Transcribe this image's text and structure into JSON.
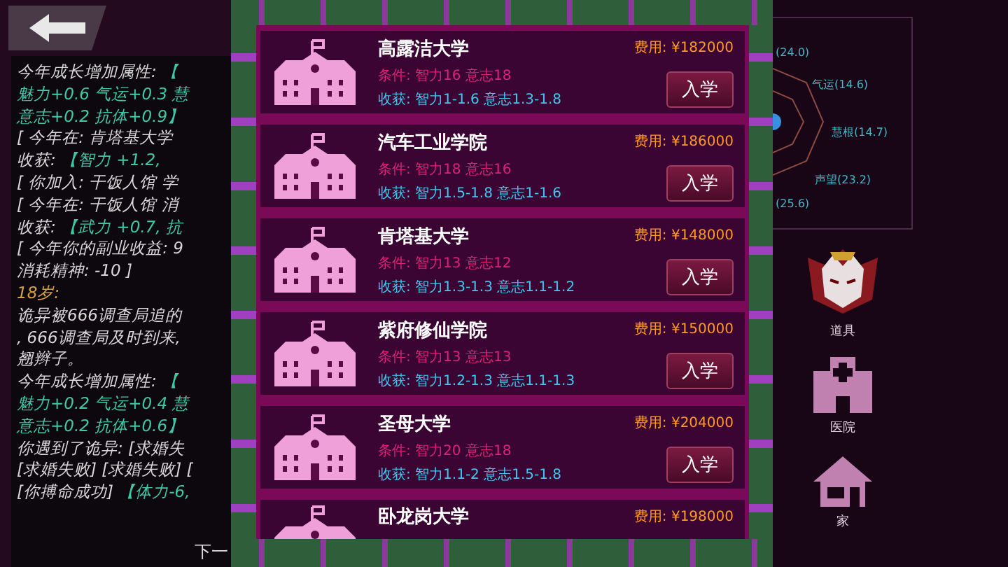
{
  "log": [
    [
      {
        "kind": "plain",
        "text": "今年成长增加属性: "
      },
      {
        "kind": "stat",
        "text": "【"
      }
    ],
    [
      {
        "kind": "stat",
        "text": "魅力+0.6 气运+0.3 慧"
      }
    ],
    [
      {
        "kind": "stat",
        "text": "意志+0.2 抗体+0.9】"
      }
    ],
    [
      {
        "kind": "plain",
        "text": "[ 今年在: 肯塔基大学"
      }
    ],
    [
      {
        "kind": "plain",
        "text": "收获: "
      },
      {
        "kind": "stat",
        "text": "【智力 +1.2,"
      }
    ],
    [
      {
        "kind": "plain",
        "text": "[ 你加入: 干饭人馆 学"
      }
    ],
    [
      {
        "kind": "plain",
        "text": "[ 今年在: 干饭人馆 消"
      }
    ],
    [
      {
        "kind": "plain",
        "text": "收获: "
      },
      {
        "kind": "stat",
        "text": "【武力 +0.7, 抗"
      }
    ],
    [
      {
        "kind": "plain",
        "text": "[ 今年你的副业收益: 9"
      }
    ],
    [
      {
        "kind": "plain",
        "text": "消耗精神: -10 ]"
      }
    ],
    [
      {
        "kind": "age",
        "text": "18岁:"
      }
    ],
    [
      {
        "kind": "plain",
        "text": "诡异被666调查局追的"
      }
    ],
    [
      {
        "kind": "plain",
        "text": ", 666调查局及时到来,"
      }
    ],
    [
      {
        "kind": "plain",
        "text": "翘辫子。"
      }
    ],
    [
      {
        "kind": "plain",
        "text": "今年成长增加属性: "
      },
      {
        "kind": "stat",
        "text": "【"
      }
    ],
    [
      {
        "kind": "stat",
        "text": "魅力+0.2 气运+0.4 慧"
      }
    ],
    [
      {
        "kind": "stat",
        "text": "意志+0.2 抗体+0.6】"
      }
    ],
    [
      {
        "kind": "plain",
        "text": "你遇到了诡异: [求婚失"
      }
    ],
    [
      {
        "kind": "plain",
        "text": "[求婚失败] [求婚失败] ["
      }
    ],
    [
      {
        "kind": "plain",
        "text": "[你搏命成功] "
      },
      {
        "kind": "stat",
        "text": "【体力-6,"
      }
    ]
  ],
  "next_year_button": "下一",
  "schools": [
    {
      "name": "高露洁大学",
      "condition": "条件: 智力16 意志18",
      "gain": "收获: 智力1-1.6 意志1.3-1.8",
      "fee": "费用: ¥182000",
      "button": "入学"
    },
    {
      "name": "汽车工业学院",
      "condition": "条件: 智力18 意志16",
      "gain": "收获: 智力1.5-1.8 意志1-1.6",
      "fee": "费用: ¥186000",
      "button": "入学"
    },
    {
      "name": "肯塔基大学",
      "condition": "条件: 智力13 意志12",
      "gain": "收获: 智力1.3-1.3 意志1.1-1.2",
      "fee": "费用: ¥148000",
      "button": "入学"
    },
    {
      "name": "紫府修仙学院",
      "condition": "条件: 智力13 意志13",
      "gain": "收获: 智力1.2-1.3 意志1.1-1.3",
      "fee": "费用: ¥150000",
      "button": "入学"
    },
    {
      "name": "圣母大学",
      "condition": "条件: 智力20 意志18",
      "gain": "收获: 智力1.1-2 意志1.5-1.8",
      "fee": "费用: ¥204000",
      "button": "入学"
    },
    {
      "name": "卧龙岗大学",
      "fee": "费用: ¥198000"
    }
  ],
  "radar_labels": [
    "(24.0)",
    "气运(14.6)",
    "慧根(14.7)",
    "声望(23.2)",
    "(25.6)"
  ],
  "side_menu": [
    {
      "kind": "mask",
      "label": "道具"
    },
    {
      "kind": "hospital",
      "label": "医院"
    },
    {
      "kind": "home",
      "label": "家"
    }
  ]
}
